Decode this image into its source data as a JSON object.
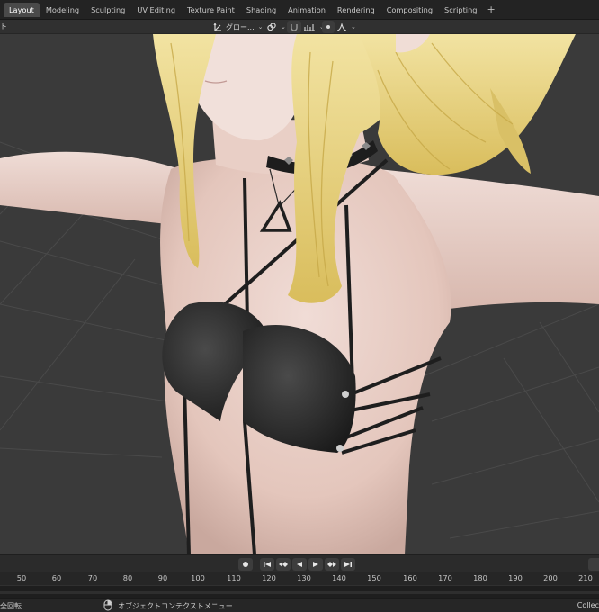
{
  "workspace_tabs": [
    {
      "label": "Layout",
      "active": true
    },
    {
      "label": "Modeling",
      "active": false
    },
    {
      "label": "Sculpting",
      "active": false
    },
    {
      "label": "UV Editing",
      "active": false
    },
    {
      "label": "Texture Paint",
      "active": false
    },
    {
      "label": "Shading",
      "active": false
    },
    {
      "label": "Animation",
      "active": false
    },
    {
      "label": "Rendering",
      "active": false
    },
    {
      "label": "Compositing",
      "active": false
    },
    {
      "label": "Scripting",
      "active": false
    }
  ],
  "add_workspace_label": "+",
  "viewport_header": {
    "left_label": "ト",
    "orientation_label": "グロー...",
    "icons": [
      "transform-orientation-icon",
      "pivot-link-icon",
      "snap-magnet-icon",
      "snap-increment-icon",
      "proportional-edit-icon",
      "falloff-curve-icon"
    ]
  },
  "playback": {
    "buttons": [
      "record",
      "jump-to-start",
      "previous-keyframe",
      "play-reverse",
      "play",
      "next-keyframe",
      "jump-to-end"
    ]
  },
  "timeline": {
    "frames": [
      "50",
      "60",
      "70",
      "80",
      "90",
      "100",
      "110",
      "120",
      "130",
      "140",
      "150",
      "160",
      "170",
      "180",
      "190",
      "200",
      "210"
    ]
  },
  "status_bar": {
    "left_text": "全回転",
    "middle_text": "オブジェクトコンテクストメニュー",
    "right_text": "Collec"
  },
  "colors": {
    "viewport_bg": "#3a3a3a",
    "active_tab": "#4a4a4a",
    "hair": "#e6cf7a",
    "skin": "#ead0c8"
  }
}
